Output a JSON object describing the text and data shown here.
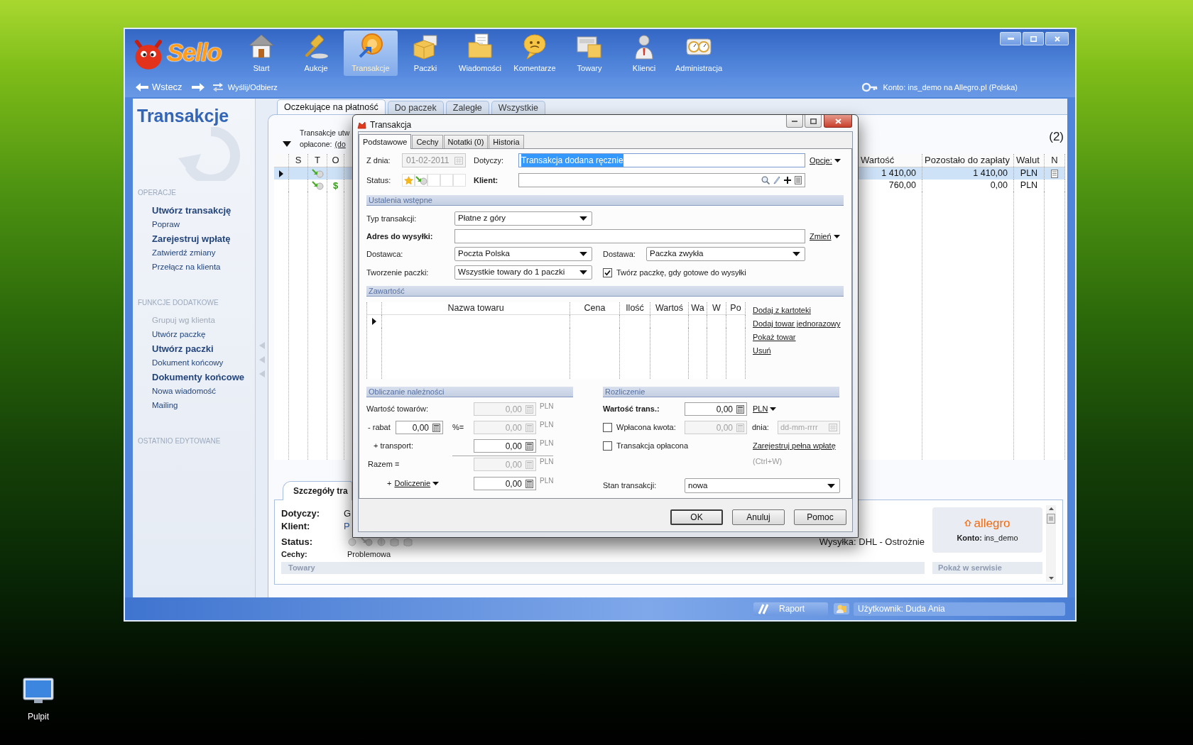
{
  "desktop": {
    "icons": [
      {
        "label": "Pulpit"
      }
    ]
  },
  "app": {
    "logo": "Sello",
    "toolbar": [
      {
        "label": "Start",
        "selected": false
      },
      {
        "label": "Aukcje",
        "selected": false
      },
      {
        "label": "Transakcje",
        "selected": true
      },
      {
        "label": "Paczki",
        "selected": false
      },
      {
        "label": "Wiadomości",
        "selected": false
      },
      {
        "label": "Komentarze",
        "selected": false
      },
      {
        "label": "Towary",
        "selected": false
      },
      {
        "label": "Klienci",
        "selected": false
      },
      {
        "label": "Administracja",
        "selected": false
      }
    ],
    "nav": {
      "back": "Wstecz",
      "sync": "Wyślij/Odbierz",
      "account": "Konto: ins_demo na Allegro.pl (Polska)"
    },
    "sidebar": {
      "title": "Transakcje",
      "sections": [
        {
          "heading": "OPERACJE",
          "items": [
            {
              "label": "Utwórz transakcję",
              "bold": true,
              "disabled": false
            },
            {
              "label": "Popraw",
              "bold": false,
              "disabled": false
            },
            {
              "label": "Zarejestruj wpłatę",
              "bold": true,
              "disabled": false
            },
            {
              "label": "Zatwierdź zmiany",
              "bold": false,
              "disabled": false
            },
            {
              "label": "Przełącz na klienta",
              "bold": false,
              "disabled": false
            }
          ]
        },
        {
          "heading": "FUNKCJE DODATKOWE",
          "items": [
            {
              "label": "Grupuj wg klienta",
              "bold": false,
              "disabled": true
            },
            {
              "label": "Utwórz paczkę",
              "bold": false,
              "disabled": false
            },
            {
              "label": "Utwórz paczki",
              "bold": true,
              "disabled": false
            },
            {
              "label": "Dokument końcowy",
              "bold": false,
              "disabled": false
            },
            {
              "label": "Dokumenty końcowe",
              "bold": true,
              "disabled": false
            },
            {
              "label": "Nowa wiadomość",
              "bold": false,
              "disabled": false
            },
            {
              "label": "Mailing",
              "bold": false,
              "disabled": false
            }
          ]
        },
        {
          "heading": "OSTATNIO EDYTOWANE"
        }
      ]
    },
    "tabs": [
      {
        "label": "Oczekujące na płatność",
        "selected": true
      },
      {
        "label": "Do paczek",
        "selected": false
      },
      {
        "label": "Zaległe",
        "selected": false
      },
      {
        "label": "Wszystkie",
        "selected": false
      }
    ],
    "summary": {
      "line_1": "Transakcje utw",
      "line_2": "opłacone:",
      "link": "(do",
      "count": "(2)"
    },
    "table": {
      "columns": {
        "left": [
          "S",
          "T",
          "O"
        ],
        "right": [
          "Wartość",
          "Pozostało do zapłaty",
          "Walut",
          "N"
        ]
      },
      "rows": [
        {
          "selected": true,
          "note": true,
          "value": "1 410,00",
          "remaining": "1 410,00",
          "currency": "PLN"
        },
        {
          "selected": false,
          "note": false,
          "payment_mark": "$",
          "value": "760,00",
          "remaining": "0,00",
          "currency": "PLN"
        }
      ]
    },
    "details": {
      "tab": "Szczegóły tra",
      "subject": {
        "label": "Dotyczy:",
        "value": "G"
      },
      "client": {
        "label": "Klient:",
        "value": "P"
      },
      "status": {
        "label": "Status:"
      },
      "shipping": "Wysyłka: DHL - Ostrożnie",
      "features": {
        "label": "Cechy:",
        "value": "Problemowa"
      },
      "goods": "Towary",
      "allegro": {
        "logo": "allegro",
        "account": "**Konto:** ins_demo"
      },
      "service": "Pokaż w serwisie"
    },
    "status_bar": {
      "report": "Raport",
      "user": "Użytkownik: Duda Ania"
    }
  },
  "dialog": {
    "title": "Transakcja",
    "tabs": [
      {
        "label": "Podstawowe",
        "selected": true
      },
      {
        "label": "Cechy",
        "selected": false
      },
      {
        "label": "Notatki (0)",
        "selected": false
      },
      {
        "label": "Historia",
        "selected": false
      }
    ],
    "date": {
      "label": "Z dnia:",
      "value": "01-02-2011",
      "disabled": true
    },
    "subject": {
      "label": "Dotyczy:",
      "value": "Transakcja dodana ręcznie",
      "highlighted": true
    },
    "options": "Opcje:",
    "status": {
      "label": "Status:",
      "slots": [
        {
          "kind": "star"
        },
        {
          "kind": "transfer"
        },
        {
          "kind": "empty"
        },
        {
          "kind": "empty"
        },
        {
          "kind": "empty"
        }
      ]
    },
    "client": {
      "label": "Klient:"
    },
    "setup": {
      "heading": "Ustalenia wstępne",
      "type": {
        "label": "Typ transakcji:",
        "value": "Płatne z góry"
      },
      "address": {
        "label": "Adres do wysyłki:",
        "change": "Zmień"
      },
      "carrier": {
        "label": "Dostawca:",
        "value": "Poczta Polska"
      },
      "delivery": {
        "label": "Dostawa:",
        "value": "Paczka zwykła"
      },
      "packing": {
        "label": "Tworzenie paczki:",
        "value": "Wszystkie towary do 1 paczki"
      },
      "auto_pack": {
        "label": "Twórz paczkę, gdy gotowe do wysyłki",
        "checked": true
      }
    },
    "contents": {
      "heading": "Zawartość",
      "columns": [
        "Nazwa towaru",
        "Cena",
        "Ilość",
        "Wartoś",
        "Wa",
        "W",
        "Po"
      ],
      "actions": [
        "Dodaj z kartoteki",
        "Dodaj towar jednorazowy",
        "Pokaż towar",
        "Usuń"
      ]
    },
    "charges": {
      "heading": "Obliczanie należności",
      "goods": {
        "label": "Wartość towarów:",
        "value": "0,00",
        "disabled": true,
        "currency": "PLN"
      },
      "discount": {
        "label": "- rabat",
        "input": "0,00",
        "operator": "%=",
        "value": "0,00",
        "disabled": true,
        "currency": "PLN"
      },
      "transport": {
        "label": "+ transport:",
        "value": "0,00",
        "disabled": false,
        "currency": "PLN"
      },
      "total": {
        "label": "Razem =",
        "value": "0,00",
        "disabled": true,
        "currency": "PLN"
      },
      "extra": {
        "prefix": "+",
        "label": "Doliczenie",
        "value": "0,00",
        "disabled": false,
        "currency": "PLN"
      }
    },
    "settlement": {
      "heading": "Rozliczenie",
      "value": {
        "label": "Wartość trans.:",
        "value": "0,00",
        "currency": "PLN"
      },
      "paid_amount": {
        "label": "Wpłacona kwota:",
        "checked": false,
        "value": "0,00",
        "disabled": true,
        "date_label": "dnia:",
        "date_placeholder": "dd-mm-rrrr"
      },
      "paid": {
        "label": "Transakcja opłacona",
        "checked": false
      },
      "register": "Zarejestruj pełna wpłatę",
      "shortcut": "(Ctrl+W)",
      "state": {
        "label": "Stan transakcji:",
        "value": "nowa"
      }
    },
    "buttons": [
      {
        "label": "OK",
        "default": true
      },
      {
        "label": "Anuluj",
        "default": false
      },
      {
        "label": "Pomoc",
        "default": false
      }
    ]
  }
}
